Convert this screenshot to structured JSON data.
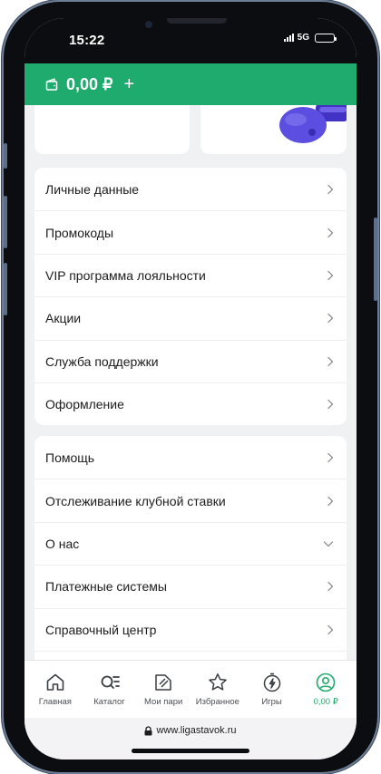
{
  "status_bar": {
    "time": "15:22",
    "network": "5G"
  },
  "header": {
    "balance": "0,00 ₽",
    "add_label": "+"
  },
  "menu_primary": [
    {
      "label": "Личные данные"
    },
    {
      "label": "Промокоды"
    },
    {
      "label": "VIP программа лояльности"
    },
    {
      "label": "Акции"
    },
    {
      "label": "Служба поддержки"
    },
    {
      "label": "Оформление"
    }
  ],
  "menu_secondary": [
    {
      "label": "Помощь"
    },
    {
      "label": "Отслеживание клубной ставки"
    },
    {
      "label": "О нас"
    },
    {
      "label": "Платежные системы"
    },
    {
      "label": "Справочный центр"
    }
  ],
  "tabs": [
    {
      "label": "Главная",
      "icon": "home-icon"
    },
    {
      "label": "Каталог",
      "icon": "catalog-search-icon"
    },
    {
      "label": "Мои пари",
      "icon": "ticket-icon"
    },
    {
      "label": "Избранное",
      "icon": "star-icon"
    },
    {
      "label": "Игры",
      "icon": "lightning-icon"
    },
    {
      "label": "0,00 ₽",
      "icon": "profile-icon"
    }
  ],
  "browser": {
    "url": "www.ligastavok.ru"
  },
  "colors": {
    "accent": "#1fab6e",
    "background": "#f0f1f3",
    "whistle": "#5b4ee0"
  }
}
